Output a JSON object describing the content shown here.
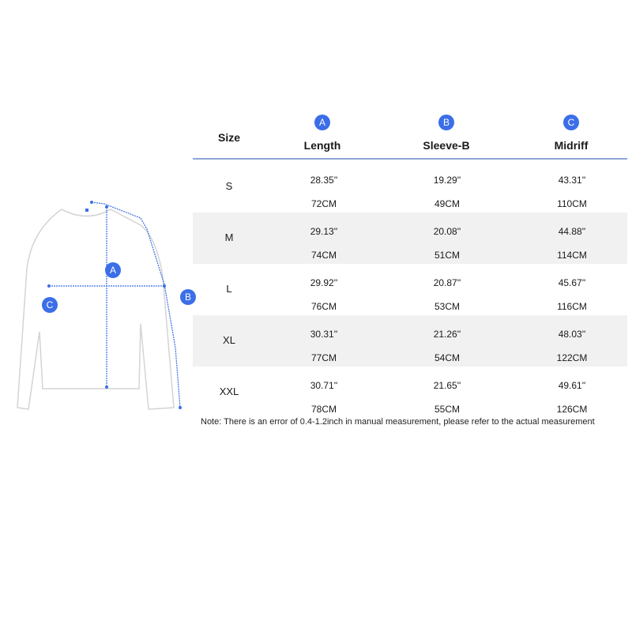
{
  "diagram": {
    "badges": {
      "a": "A",
      "b": "B",
      "c": "C"
    }
  },
  "table": {
    "size_header": "Size",
    "columns": [
      {
        "badge": "A",
        "label": "Length"
      },
      {
        "badge": "B",
        "label": "Sleeve-B"
      },
      {
        "badge": "C",
        "label": "Midriff"
      }
    ],
    "rows": [
      {
        "size": "S",
        "length_in": "28.35''",
        "length_cm": "72CM",
        "sleeve_in": "19.29''",
        "sleeve_cm": "49CM",
        "midriff_in": "43.31''",
        "midriff_cm": "110CM"
      },
      {
        "size": "M",
        "length_in": "29.13''",
        "length_cm": "74CM",
        "sleeve_in": "20.08''",
        "sleeve_cm": "51CM",
        "midriff_in": "44.88''",
        "midriff_cm": "114CM"
      },
      {
        "size": "L",
        "length_in": "29.92''",
        "length_cm": "76CM",
        "sleeve_in": "20.87''",
        "sleeve_cm": "53CM",
        "midriff_in": "45.67''",
        "midriff_cm": "116CM"
      },
      {
        "size": "XL",
        "length_in": "30.31''",
        "length_cm": "77CM",
        "sleeve_in": "21.26''",
        "sleeve_cm": "54CM",
        "midriff_in": "48.03''",
        "midriff_cm": "122CM"
      },
      {
        "size": "XXL",
        "length_in": "30.71''",
        "length_cm": "78CM",
        "sleeve_in": "21.65''",
        "sleeve_cm": "55CM",
        "midriff_in": "49.61''",
        "midriff_cm": "126CM"
      }
    ],
    "note": "Note: There is an error of 0.4-1.2inch in manual measurement, please refer to the actual measurement"
  },
  "colors": {
    "accent": "#3b6ee8",
    "row_shade": "#f1f1f1",
    "rule": "#8fa6d9",
    "outline": "#d4d4d4"
  }
}
